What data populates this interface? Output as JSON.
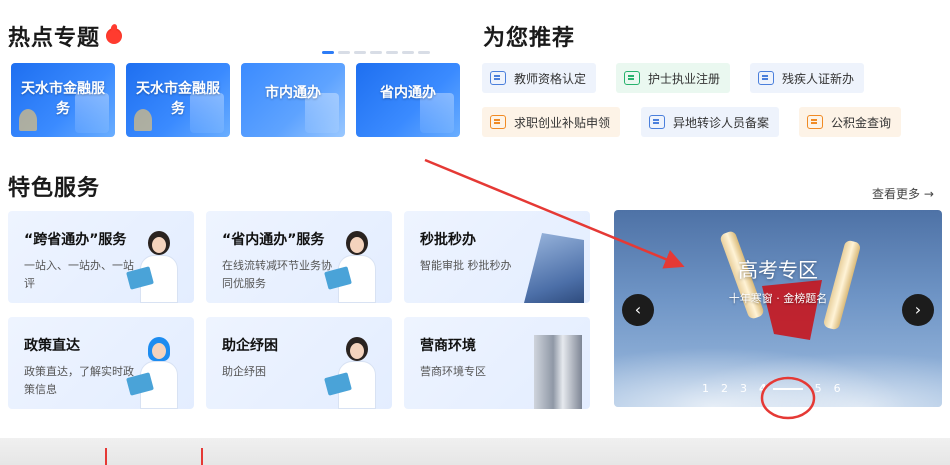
{
  "hot_topics": {
    "title": "热点专题",
    "cards": [
      {
        "label": "天水市金融服务"
      },
      {
        "label": "天水市金融服务"
      },
      {
        "label": "市内通办"
      },
      {
        "label": "省内通办"
      }
    ]
  },
  "recommend": {
    "title": "为您推荐",
    "items": [
      {
        "label": "教师资格认定",
        "icon": "certificate-icon"
      },
      {
        "label": "护士执业注册",
        "icon": "house-icon"
      },
      {
        "label": "残疾人证新办",
        "icon": "id-card-icon"
      },
      {
        "label": "求职创业补贴申领",
        "icon": "briefcase-icon"
      },
      {
        "label": "异地转诊人员备案",
        "icon": "document-icon"
      },
      {
        "label": "公积金查询",
        "icon": "card-icon"
      }
    ]
  },
  "featured": {
    "title": "特色服务",
    "more": "查看更多 →",
    "cards": [
      {
        "title": "“跨省通办”服务",
        "desc": "一站入、一站办、一站评"
      },
      {
        "title": "“省内通办”服务",
        "desc": "在线流转减环节业务协同优服务"
      },
      {
        "title": "秒批秒办",
        "desc": "智能审批 秒批秒办"
      },
      {
        "title": "政策直达",
        "desc": "政策直达，了解实时政策信息"
      },
      {
        "title": "助企纾困",
        "desc": "助企纾困"
      },
      {
        "title": "营商环境",
        "desc": "营商环境专区"
      }
    ]
  },
  "banner": {
    "title": "高考专区",
    "subtitle": "十年寒窗 · 金榜题名",
    "pages": [
      "1",
      "2",
      "3",
      "4",
      "5",
      "6"
    ],
    "current_page": "4"
  },
  "colors": {
    "accent": "#2d7cf6",
    "annotation": "#e53935"
  }
}
